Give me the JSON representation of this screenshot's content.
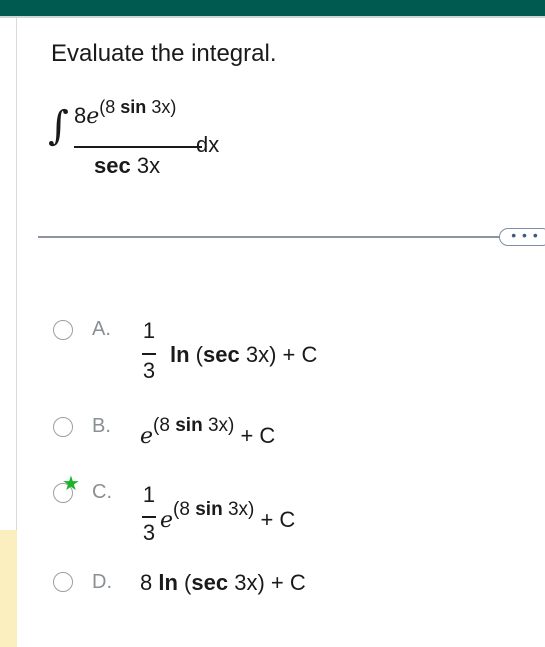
{
  "question": {
    "title": "Evaluate the integral.",
    "integral": {
      "sign": "∫",
      "numerator_coef": "8",
      "e": "e",
      "exponent_open": "(8 ",
      "exponent_fn": "sin",
      "exponent_close": " 3x)",
      "denominator_fn": "sec",
      "denominator_arg": " 3x",
      "dx": "dx"
    }
  },
  "more_button": {
    "label": "• • •"
  },
  "options": [
    {
      "letter": "A.",
      "frac_num": "1",
      "frac_den": "3",
      "fn": "ln",
      "paren_open": " (",
      "inner_fn": "sec",
      "inner_arg": " 3x) + C",
      "selected": false
    },
    {
      "letter": "B.",
      "e": "e",
      "exp_open": "(8 ",
      "exp_fn": "sin",
      "exp_close": " 3x)",
      "tail": " + C",
      "selected": false
    },
    {
      "letter": "C.",
      "frac_num": "1",
      "frac_den": "3",
      "e": "e",
      "exp_open": "(8 ",
      "exp_fn": "sin",
      "exp_close": " 3x)",
      "tail": " + C",
      "selected": true,
      "correct_marker": "★"
    },
    {
      "letter": "D.",
      "coef": "8 ",
      "fn": "ln",
      "paren_open": " (",
      "inner_fn": "sec",
      "inner_arg": " 3x) + C",
      "selected": false
    }
  ],
  "colors": {
    "header": "#005a4f",
    "correct_star": "#1db32b",
    "highlight": "#fbefc0"
  }
}
